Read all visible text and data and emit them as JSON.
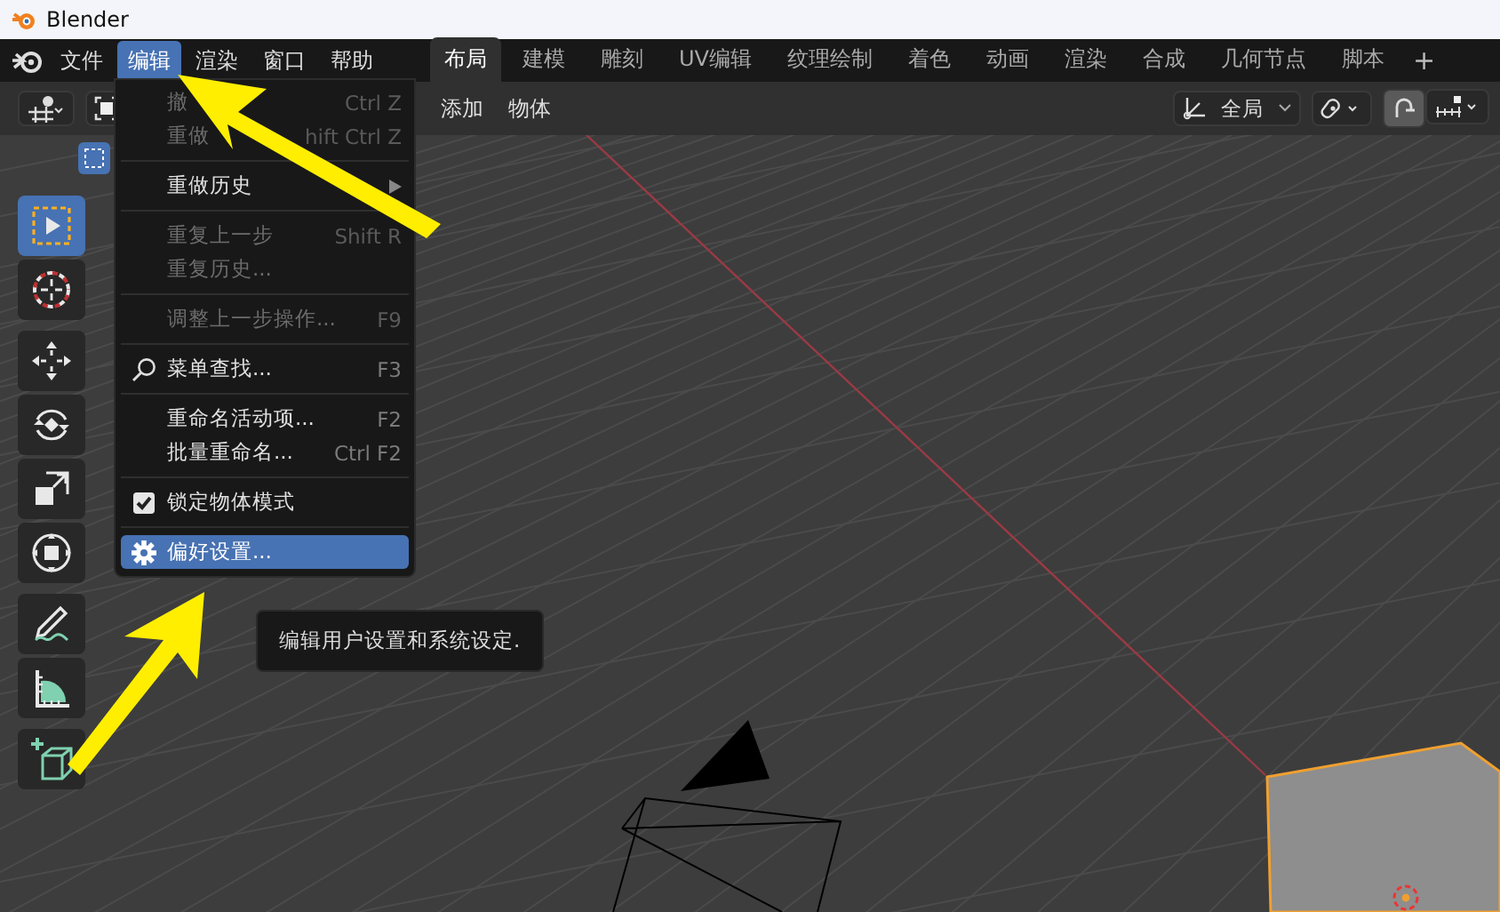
{
  "window": {
    "title": "Blender"
  },
  "menubar": [
    {
      "label": "文件",
      "selected": false
    },
    {
      "label": "编辑",
      "selected": true
    },
    {
      "label": "渲染",
      "selected": false
    },
    {
      "label": "窗口",
      "selected": false
    },
    {
      "label": "帮助",
      "selected": false
    }
  ],
  "workspace_tabs": [
    {
      "label": "布局",
      "selected": true
    },
    {
      "label": "建模",
      "selected": false
    },
    {
      "label": "雕刻",
      "selected": false
    },
    {
      "label": "UV编辑",
      "selected": false
    },
    {
      "label": "纹理绘制",
      "selected": false
    },
    {
      "label": "着色",
      "selected": false
    },
    {
      "label": "动画",
      "selected": false
    },
    {
      "label": "渲染",
      "selected": false
    },
    {
      "label": "合成",
      "selected": false
    },
    {
      "label": "几何节点",
      "selected": false
    },
    {
      "label": "脚本",
      "selected": false
    }
  ],
  "add_tab": "+",
  "header": {
    "menus": [
      "添加",
      "物体"
    ],
    "orientation": "全局",
    "snap": {
      "on": true
    }
  },
  "toolbar": [
    [
      {
        "kind": "select_box",
        "selected": true
      },
      {
        "kind": "cursor",
        "selected": false
      }
    ],
    [
      {
        "kind": "move",
        "selected": false
      },
      {
        "kind": "rotate",
        "selected": false
      },
      {
        "kind": "scale",
        "selected": false
      },
      {
        "kind": "transform",
        "selected": false
      }
    ],
    [
      {
        "kind": "annotate",
        "selected": false
      },
      {
        "kind": "measure",
        "selected": false
      }
    ],
    [
      {
        "kind": "add_cube",
        "selected": false
      }
    ]
  ],
  "edit_menu": [
    {
      "kind": "item",
      "label": "撤",
      "shortcut": "Ctrl Z",
      "disabled": true,
      "selected": false
    },
    {
      "kind": "item",
      "label": "重做",
      "shortcut": "hift Ctrl Z",
      "disabled": true,
      "selected": false
    },
    {
      "kind": "separator"
    },
    {
      "kind": "submenu",
      "label": "重做历史",
      "disabled": false,
      "selected": false
    },
    {
      "kind": "separator"
    },
    {
      "kind": "item",
      "label": "重复上一步",
      "shortcut": "Shift R",
      "disabled": true,
      "selected": false
    },
    {
      "kind": "item",
      "label": "重复历史...",
      "disabled": true,
      "selected": false
    },
    {
      "kind": "separator"
    },
    {
      "kind": "item",
      "label": "调整上一步操作...",
      "shortcut": "F9",
      "disabled": true,
      "selected": false
    },
    {
      "kind": "separator"
    },
    {
      "kind": "search",
      "label": "菜单查找...",
      "shortcut": "F3",
      "disabled": false,
      "selected": false
    },
    {
      "kind": "separator"
    },
    {
      "kind": "item",
      "label": "重命名活动项...",
      "shortcut": "F2",
      "disabled": false,
      "selected": false
    },
    {
      "kind": "item",
      "label": "批量重命名...",
      "shortcut": "Ctrl F2",
      "disabled": false,
      "selected": false
    },
    {
      "kind": "separator"
    },
    {
      "kind": "checkbox",
      "label": "锁定物体模式",
      "checked": true,
      "disabled": false,
      "selected": false
    },
    {
      "kind": "separator"
    },
    {
      "kind": "gear",
      "label": "偏好设置...",
      "disabled": false,
      "selected": true
    }
  ],
  "tooltip": "编辑用户设置和系统设定."
}
